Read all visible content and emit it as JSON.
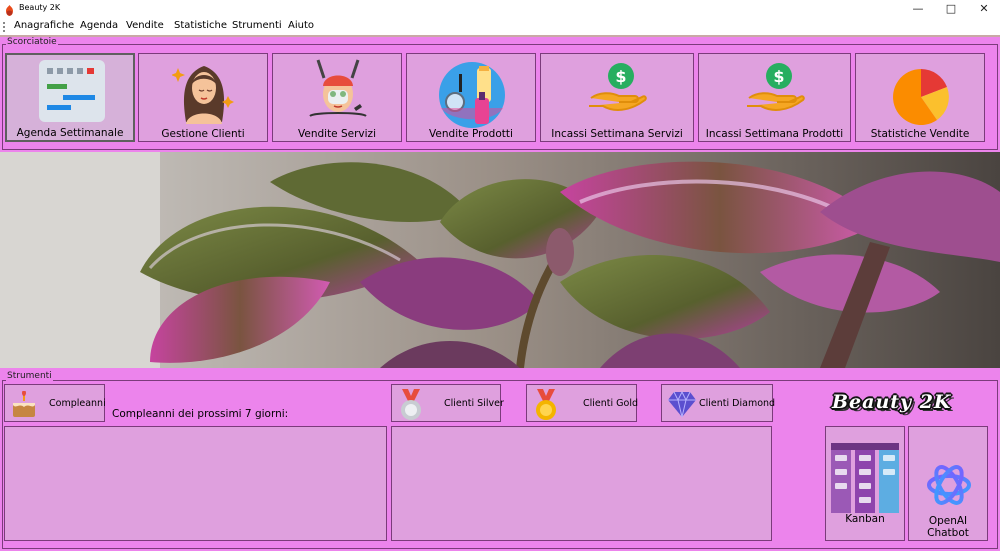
{
  "window": {
    "title": "Beauty 2K"
  },
  "menu": [
    "Anagrafiche",
    "Agenda",
    "Vendite",
    "Statistiche",
    "Strumenti",
    "Aiuto"
  ],
  "shortcuts": {
    "label": "Scorciatoie",
    "items": [
      {
        "label": "Agenda Settimanale",
        "icon": "calendar-schedule-icon"
      },
      {
        "label": "Gestione Clienti",
        "icon": "woman-face-icon"
      },
      {
        "label": "Vendite Servizi",
        "icon": "facial-treatment-icon"
      },
      {
        "label": "Vendite Prodotti",
        "icon": "cosmetics-icon"
      },
      {
        "label": "Incassi Settimana Servizi",
        "icon": "hand-coin-icon"
      },
      {
        "label": "Incassi Settimana Prodotti",
        "icon": "hand-coin-icon"
      },
      {
        "label": "Statistiche Vendite",
        "icon": "pie-chart-icon"
      }
    ]
  },
  "tools": {
    "label": "Strumenti",
    "birthday_button": "Compleanni",
    "birthday_caption": "Compleanni dei prossimi 7 giorni:",
    "silver_button": "Clienti Silver",
    "gold_button": "Clienti Gold",
    "diamond_button": "Clienti Diamond",
    "logo": "Beauty 2K",
    "kanban_button": "Kanban",
    "chatbot_button_line1": "OpenAI",
    "chatbot_button_line2": "Chatbot"
  },
  "colors": {
    "background": "#ec84ec",
    "tile": "#dfa0de",
    "border": "#7b3b7b"
  }
}
